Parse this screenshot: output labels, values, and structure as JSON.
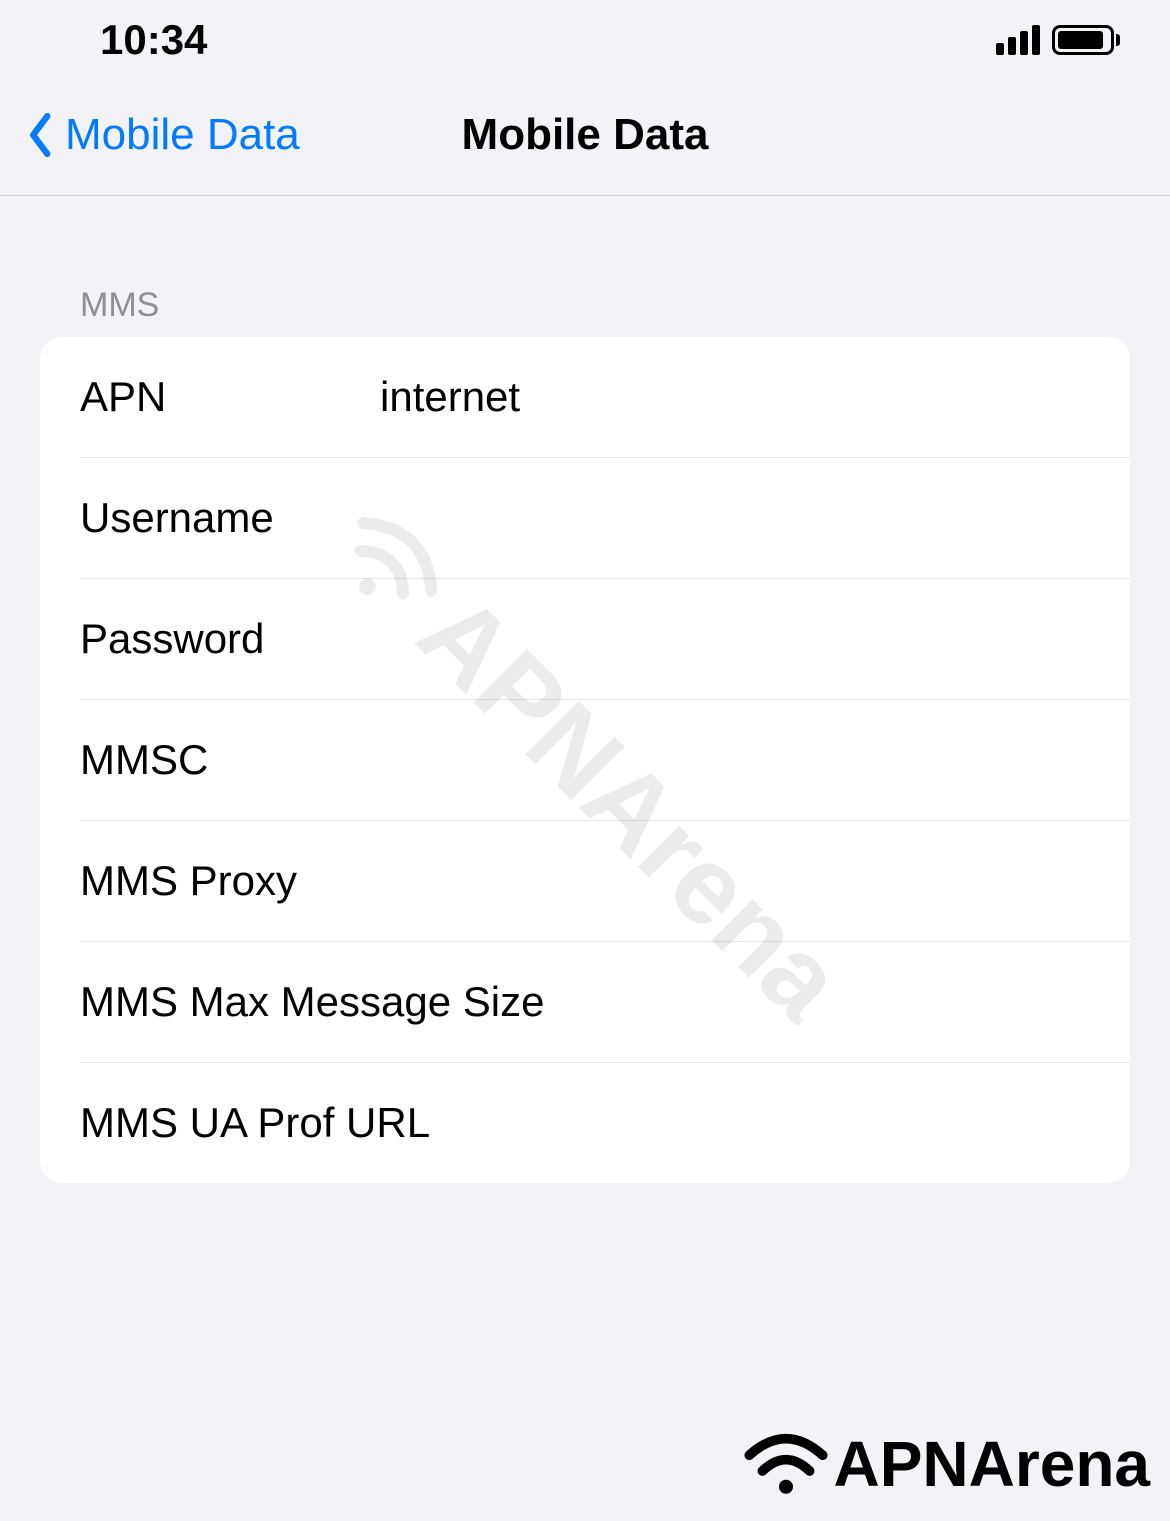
{
  "status_bar": {
    "time": "10:34"
  },
  "nav": {
    "back_label": "Mobile Data",
    "title": "Mobile Data"
  },
  "section": {
    "header": "MMS"
  },
  "fields": {
    "apn": {
      "label": "APN",
      "value": "internet"
    },
    "username": {
      "label": "Username",
      "value": ""
    },
    "password": {
      "label": "Password",
      "value": ""
    },
    "mmsc": {
      "label": "MMSC",
      "value": ""
    },
    "mms_proxy": {
      "label": "MMS Proxy",
      "value": ""
    },
    "mms_max_size": {
      "label": "MMS Max Message Size",
      "value": ""
    },
    "mms_ua_prof": {
      "label": "MMS UA Prof URL",
      "value": ""
    }
  },
  "watermark": {
    "text": "APNArena"
  },
  "footer": {
    "brand": "APNArena"
  }
}
